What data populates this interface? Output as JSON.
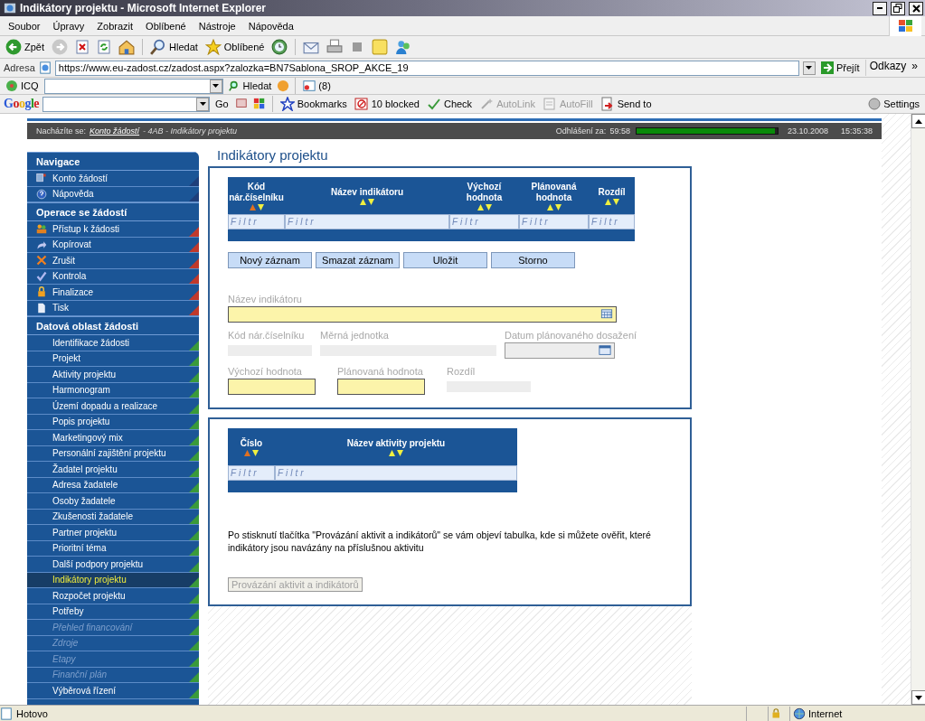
{
  "window": {
    "title": "Indikátory projektu - Microsoft Internet Explorer"
  },
  "menu": [
    "Soubor",
    "Úpravy",
    "Zobrazit",
    "Oblíbené",
    "Nástroje",
    "Nápověda"
  ],
  "toolbar": [
    {
      "kind": "back",
      "label": "Zpět"
    },
    {
      "kind": "forward"
    },
    {
      "kind": "stop"
    },
    {
      "kind": "refresh"
    },
    {
      "kind": "home"
    },
    {
      "kind": "search",
      "label": "Hledat"
    },
    {
      "kind": "favorites",
      "label": "Oblíbené"
    },
    {
      "kind": "history"
    },
    {
      "kind": "mail"
    },
    {
      "kind": "print"
    },
    {
      "kind": "edit"
    },
    {
      "kind": "note"
    },
    {
      "kind": "messenger"
    }
  ],
  "address": {
    "label": "Adresa",
    "url": "https://www.eu-zadost.cz/zadost.aspx?zalozka=BN7Sablona_SROP_AKCE_19",
    "go": "Přejít",
    "links": "Odkazy",
    "more": "»"
  },
  "icq_bar": {
    "label": "ICQ",
    "search": "Hledat",
    "count": "(8)"
  },
  "google_bar": {
    "logo": "Google",
    "go": "Go",
    "settings": "Settings",
    "buttons": [
      {
        "kind": "bookmarks",
        "label": "Bookmarks",
        "disabled": false
      },
      {
        "kind": "blocked",
        "label": "10 blocked",
        "disabled": false
      },
      {
        "kind": "check",
        "label": "Check",
        "disabled": false
      },
      {
        "kind": "autolink",
        "label": "AutoLink",
        "disabled": true
      },
      {
        "kind": "autofill",
        "label": "AutoFill",
        "disabled": true
      },
      {
        "kind": "sendto",
        "label": "Send to",
        "disabled": false
      }
    ]
  },
  "breadcrumb": {
    "prefix": "Nacházíte se:",
    "link": "Konto žádostí",
    "rest": "- 4AB - Indikátory projektu"
  },
  "session": {
    "label": "Odhlášení za:",
    "time": "59:58",
    "level": 0.98,
    "date": "23.10.2008",
    "clock": "15:35:38"
  },
  "sidebar": {
    "groups": [
      {
        "title": "Navigace",
        "kind": "iconic",
        "color": "#1f3f7a",
        "items": [
          {
            "label": "Konto žádostí",
            "selected": false,
            "disabled": false
          },
          {
            "label": "Nápověda",
            "selected": false,
            "disabled": false
          }
        ]
      },
      {
        "title": "Operace se žádostí",
        "kind": "iconic",
        "color": "#c0392b",
        "items": [
          {
            "label": "Přístup k žádosti",
            "selected": false,
            "disabled": false
          },
          {
            "label": "Kopírovat",
            "selected": false,
            "disabled": false
          },
          {
            "label": "Zrušit",
            "selected": false,
            "disabled": false
          },
          {
            "label": "Kontrola",
            "selected": false,
            "disabled": false
          },
          {
            "label": "Finalizace",
            "selected": false,
            "disabled": false
          },
          {
            "label": "Tisk",
            "selected": false,
            "disabled": false
          }
        ]
      },
      {
        "title": "Datová oblast žádosti",
        "kind": "plain",
        "color": "#3a9a3a",
        "items": [
          {
            "label": "Identifikace žádosti",
            "selected": false,
            "disabled": false
          },
          {
            "label": "Projekt",
            "selected": false,
            "disabled": false
          },
          {
            "label": "Aktivity projektu",
            "selected": false,
            "disabled": false
          },
          {
            "label": "Harmonogram",
            "selected": false,
            "disabled": false
          },
          {
            "label": "Území dopadu a realizace",
            "selected": false,
            "disabled": false
          },
          {
            "label": "Popis projektu",
            "selected": false,
            "disabled": false
          },
          {
            "label": "Marketingový mix",
            "selected": false,
            "disabled": false
          },
          {
            "label": "Personální zajištění projektu",
            "selected": false,
            "disabled": false
          },
          {
            "label": "Žadatel projektu",
            "selected": false,
            "disabled": false
          },
          {
            "label": "Adresa žadatele",
            "selected": false,
            "disabled": false
          },
          {
            "label": "Osoby žadatele",
            "selected": false,
            "disabled": false
          },
          {
            "label": "Zkušenosti žadatele",
            "selected": false,
            "disabled": false
          },
          {
            "label": "Partner projektu",
            "selected": false,
            "disabled": false
          },
          {
            "label": "Prioritní téma",
            "selected": false,
            "disabled": false
          },
          {
            "label": "Další podpory projektu",
            "selected": false,
            "disabled": false
          },
          {
            "label": "Indikátory projektu",
            "selected": true,
            "disabled": false
          },
          {
            "label": "Rozpočet projektu",
            "selected": false,
            "disabled": false
          },
          {
            "label": "Potřeby",
            "selected": false,
            "disabled": false
          },
          {
            "label": "Přehled financování",
            "selected": false,
            "disabled": true
          },
          {
            "label": "Zdroje",
            "selected": false,
            "disabled": true
          },
          {
            "label": "Etapy",
            "selected": false,
            "disabled": true
          },
          {
            "label": "Finanční plán",
            "selected": false,
            "disabled": true
          },
          {
            "label": "Výběrová řízení",
            "selected": false,
            "disabled": false
          }
        ]
      }
    ]
  },
  "page": {
    "title": "Indikátory projektu"
  },
  "indicators": {
    "columns": [
      {
        "label": "Kód nár.číselníku",
        "sorted_ascending": true,
        "filter_placeholder": "Filtr"
      },
      {
        "label": "Název indikátoru",
        "sorted_ascending": false,
        "filter_placeholder": "Filtr"
      },
      {
        "label": "Výchozí hodnota",
        "sorted_ascending": false,
        "filter_placeholder": "Filtr"
      },
      {
        "label": "Plánovaná hodnota",
        "sorted_ascending": false,
        "filter_placeholder": "Filtr"
      },
      {
        "label": "Rozdíl",
        "sorted_ascending": false,
        "filter_placeholder": "Filtr"
      }
    ],
    "buttons": [
      "Nový záznam",
      "Smazat záznam",
      "Uložit",
      "Storno"
    ],
    "fields": [
      [
        {
          "label": "Název indikátoru",
          "kind": "lookup",
          "editable": true
        }
      ],
      [
        {
          "label": "Kód nár.číselníku",
          "kind": "text",
          "editable": false
        },
        {
          "label": "Měrná jednotka",
          "kind": "text",
          "editable": false
        },
        {
          "label": "Datum plánovaného dosažení",
          "kind": "date",
          "editable": false
        }
      ],
      [
        {
          "label": "Výchozí hodnota",
          "kind": "text",
          "editable": true
        },
        {
          "label": "Plánovaná hodnota",
          "kind": "text",
          "editable": true
        },
        {
          "label": "Rozdíl",
          "kind": "text",
          "editable": false
        }
      ]
    ]
  },
  "activities": {
    "columns": [
      {
        "label": "Číslo",
        "sorted_ascending": true,
        "filter_placeholder": "Filtr"
      },
      {
        "label": "Název aktivity projektu",
        "sorted_ascending": false,
        "filter_placeholder": "Filtr"
      }
    ],
    "note": "Po stisknutí tlačítka \"Provázání aktivit a indikátorů\" se vám objeví tabulka, kde si můžete ověřit, které indikátory jsou navázány na příslušnou aktivitu",
    "button": {
      "label": "Provázání aktivit a indikátorů",
      "disabled": true
    }
  },
  "status_bar": {
    "text": "Hotovo",
    "zone": "Internet"
  }
}
